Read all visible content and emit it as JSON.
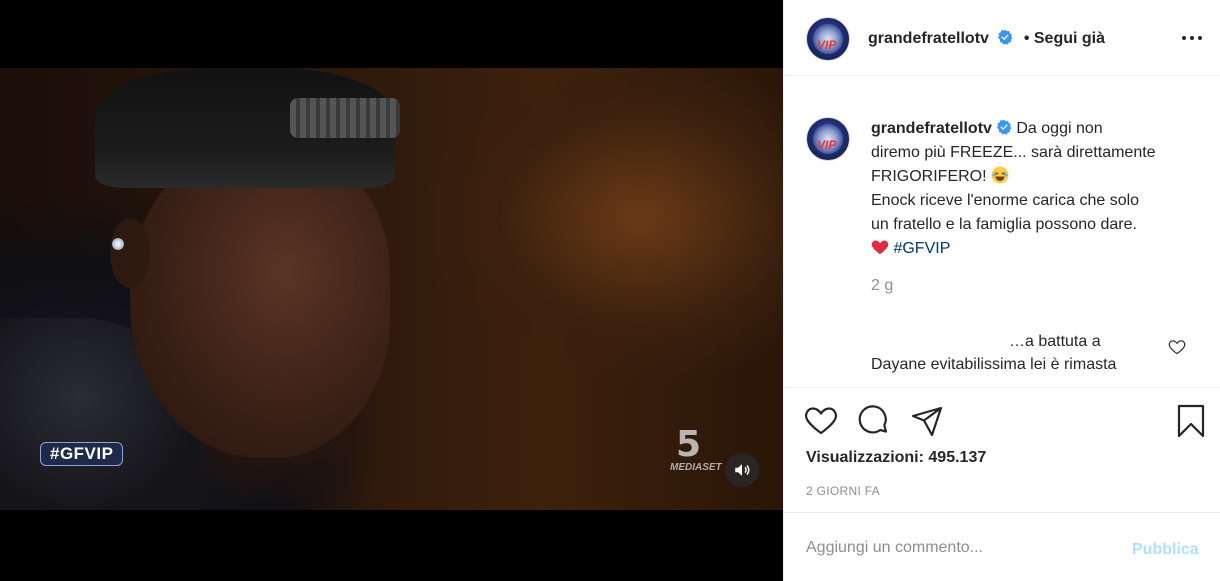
{
  "post": {
    "username": "grandefratellotv",
    "follow_label": "• Segui già",
    "caption_lines": [
      "Da oggi non",
      "diremo più FREEZE... sarà direttamente",
      "FRIGORIFERO!",
      "Enock riceve l'enorme carica che solo",
      "un fratello e la famiglia possono dare."
    ],
    "hashtag": "#GFVIP",
    "time_ago": "2 g",
    "comment_fragment_line1": "…a battuta a",
    "comment_fragment_line2": "Dayane evitabilissima lei è rimasta",
    "views": "Visualizzazioni: 495.137",
    "date": "2 GIORNI FA",
    "comment_placeholder": "Aggiungi un commento...",
    "publish_label": "Pubblica"
  },
  "video": {
    "badge": "#GFVIP",
    "channel_number": "5",
    "channel_name": "MEDIASET"
  },
  "avatar": {
    "label": "VIP"
  },
  "colors": {
    "link": "#00376b",
    "verified": "#3897f0",
    "publish_disabled": "#b2dffc",
    "heart": "#ed4956"
  },
  "icons": [
    "verified-icon",
    "more-icon",
    "heart-icon",
    "comment-icon",
    "share-icon",
    "save-icon",
    "audio-icon",
    "heart-emoji-icon",
    "laughing-emoji-icon"
  ]
}
